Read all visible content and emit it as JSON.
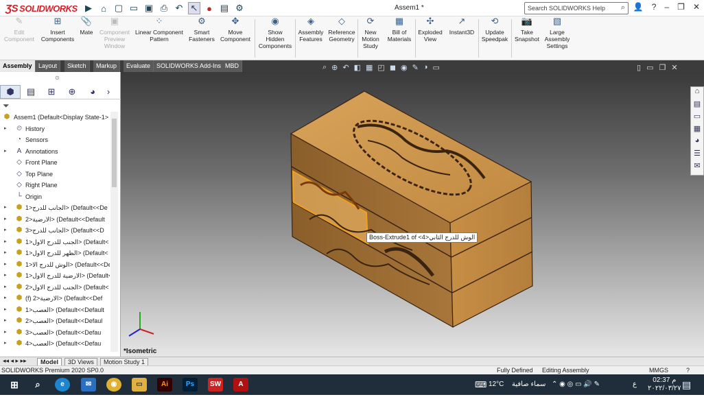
{
  "app": {
    "logo": "SOLIDWORKS",
    "doc_title": "Assem1 *"
  },
  "search": {
    "placeholder": "Search SOLIDWORKS Help"
  },
  "ribbon": [
    {
      "label": "Edit\nComponent",
      "icon": "edit-component-icon",
      "disabled": true
    },
    {
      "label": "Insert\nComponents",
      "icon": "insert-components-icon",
      "disabled": false
    },
    {
      "label": "Mate",
      "icon": "mate-icon",
      "disabled": false
    },
    {
      "label": "Component\nPreview\nWindow",
      "icon": "preview-window-icon",
      "disabled": true
    },
    {
      "label": "Linear Component\nPattern",
      "icon": "pattern-icon",
      "disabled": false
    },
    {
      "label": "Smart\nFasteners",
      "icon": "fasteners-icon",
      "disabled": false
    },
    {
      "label": "Move\nComponent",
      "icon": "move-component-icon",
      "disabled": false
    },
    {
      "label": "Show\nHidden\nComponents",
      "icon": "show-hidden-icon",
      "disabled": false
    },
    {
      "label": "Assembly\nFeatures",
      "icon": "assembly-features-icon",
      "disabled": false
    },
    {
      "label": "Reference\nGeometry",
      "icon": "reference-geometry-icon",
      "disabled": false
    },
    {
      "label": "New\nMotion\nStudy",
      "icon": "motion-study-icon",
      "disabled": false
    },
    {
      "label": "Bill of\nMaterials",
      "icon": "bom-icon",
      "disabled": false
    },
    {
      "label": "Exploded\nView",
      "icon": "exploded-view-icon",
      "disabled": false
    },
    {
      "label": "Instant3D",
      "icon": "instant3d-icon",
      "disabled": false
    },
    {
      "label": "Update\nSpeedpak",
      "icon": "speedpak-icon",
      "disabled": false
    },
    {
      "label": "Take\nSnapshot",
      "icon": "snapshot-icon",
      "disabled": false
    },
    {
      "label": "Large\nAssembly\nSettings",
      "icon": "large-assembly-icon",
      "disabled": false
    }
  ],
  "tabs": [
    "Assembly",
    "Layout",
    "Sketch",
    "Markup",
    "Evaluate",
    "SOLIDWORKS Add-Ins",
    "MBD"
  ],
  "tree": {
    "root": "Assem1  (Default<Display State-1>",
    "items": [
      {
        "label": "History",
        "icon": "history-icon",
        "arrow": true
      },
      {
        "label": "Sensors",
        "icon": "sensor-icon",
        "arrow": false
      },
      {
        "label": "Annotations",
        "icon": "annotation-icon",
        "arrow": true
      },
      {
        "label": "Front Plane",
        "icon": "plane-icon",
        "arrow": false
      },
      {
        "label": "Top Plane",
        "icon": "plane-icon",
        "arrow": false
      },
      {
        "label": "Right Plane",
        "icon": "plane-icon",
        "arrow": false
      },
      {
        "label": "Origin",
        "icon": "origin-icon",
        "arrow": false
      },
      {
        "label": "الجانب للدرج<1> (Default<<De",
        "icon": "part-icon",
        "arrow": true
      },
      {
        "label": "الارضية<2> (Default<<Default",
        "icon": "part-icon",
        "arrow": true
      },
      {
        "label": "الجانب للدرج<3> (Default<<D",
        "icon": "part-icon",
        "arrow": true
      },
      {
        "label": "الجنب للدرج الاول<1> (Default<",
        "icon": "part-icon",
        "arrow": true
      },
      {
        "label": "الظهر للدرج الاول<1> (Default<",
        "icon": "part-icon",
        "arrow": true
      },
      {
        "label": "الوش للدرج الا<1> (Default<<De",
        "icon": "part-icon",
        "arrow": true
      },
      {
        "label": "الارضية للدرج الاول<1> (Default<",
        "icon": "part-icon",
        "arrow": true
      },
      {
        "label": "الجنب للدرج الاول<2> (Default<",
        "icon": "part-icon",
        "arrow": true
      },
      {
        "label": "(f) الارضية<2> (Default<<Def",
        "icon": "part-icon",
        "arrow": true
      },
      {
        "label": "العصب<1> (Default<<Default",
        "icon": "part-icon",
        "arrow": true
      },
      {
        "label": "العصب<2> (Default<<Defaul",
        "icon": "part-icon",
        "arrow": true
      },
      {
        "label": "العصب<3> (Default<<Defau",
        "icon": "part-icon",
        "arrow": true
      },
      {
        "label": "العصب<4> (Default<<Defau",
        "icon": "part-icon",
        "arrow": true
      }
    ]
  },
  "viewport": {
    "view_label": "*Isometric",
    "tooltip": "Boss-Extrude1 of <الوش للدرج الثاني<4"
  },
  "bottom_tabs": [
    "Model",
    "3D Views",
    "Motion Study 1"
  ],
  "status": {
    "product": "SOLIDWORKS Premium 2020 SP0.0",
    "defined": "Fully Defined",
    "mode": "Editing Assembly",
    "units": "MMGS"
  },
  "taskbar": {
    "temp": "12°C",
    "weather": "سماء صافية",
    "time": "02:37 م",
    "date": "٢٠٢٢/٠٣/٢٧"
  }
}
